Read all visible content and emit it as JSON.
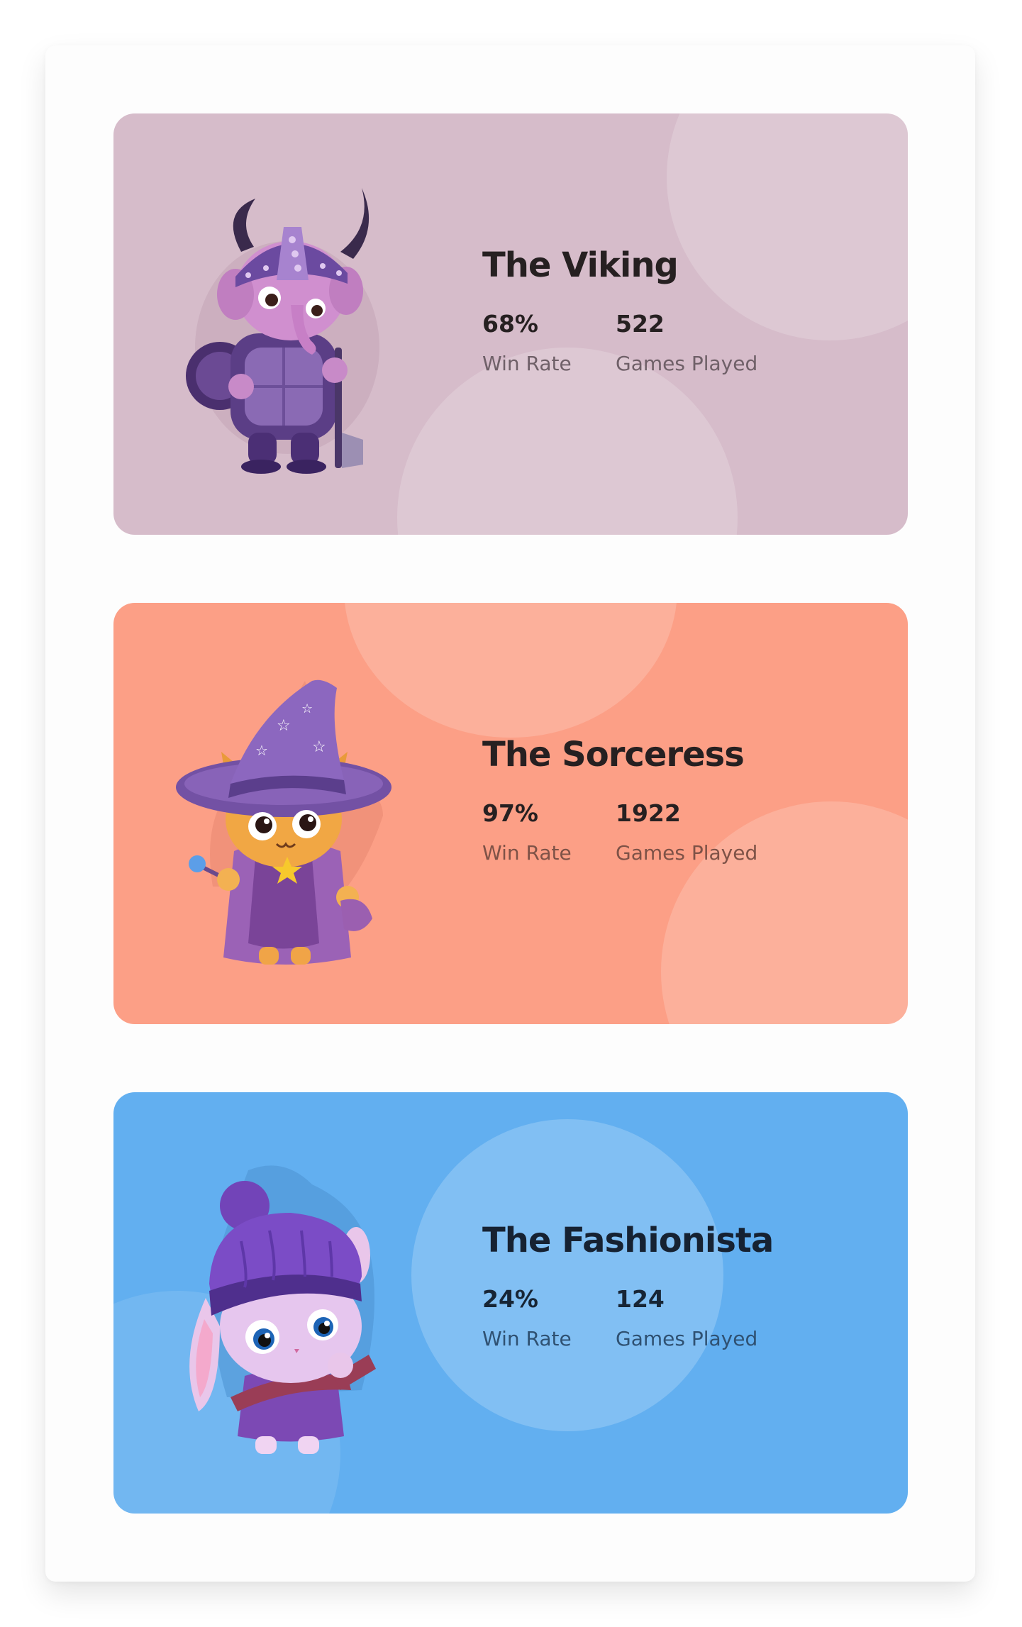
{
  "cards": [
    {
      "title": "The Viking",
      "win_rate": "68%",
      "win_rate_label": "Win Rate",
      "games_played": "522",
      "games_played_label": "Games Played",
      "character": "viking-elephant-icon",
      "background": "#d6bcca"
    },
    {
      "title": "The Sorceress",
      "win_rate": "97%",
      "win_rate_label": "Win Rate",
      "games_played": "1922",
      "games_played_label": "Games Played",
      "character": "sorceress-cat-icon",
      "background": "#fc9f86"
    },
    {
      "title": "The Fashionista",
      "win_rate": "24%",
      "win_rate_label": "Win Rate",
      "games_played": "124",
      "games_played_label": "Games Played",
      "character": "fashionista-bunny-icon",
      "background": "#62aff0"
    }
  ]
}
